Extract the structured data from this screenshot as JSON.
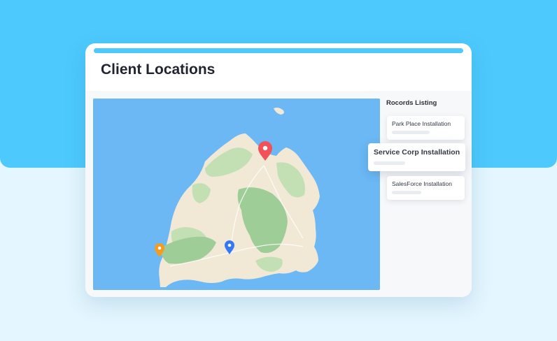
{
  "app": {
    "title": "Client Locations"
  },
  "records": {
    "heading": "Rocords Listing",
    "items": [
      {
        "label": "Park Place Installation"
      },
      {
        "label": "Service Corp Installation"
      },
      {
        "label": "SalesForce Installation"
      }
    ]
  },
  "map": {
    "markers": [
      {
        "name": "map-pin-red-icon",
        "color": "#f25158"
      },
      {
        "name": "map-pin-orange-icon",
        "color": "#f39c1f"
      },
      {
        "name": "map-pin-blue-icon",
        "color": "#3478f6"
      }
    ],
    "colors": {
      "water": "#6bb8f5",
      "land": "#f1e9d5",
      "vegetation": "#c3e0b5",
      "forest": "#9fcd97"
    }
  },
  "colors": {
    "accent": "#4dc9fd",
    "background": "#e4f6ff"
  }
}
